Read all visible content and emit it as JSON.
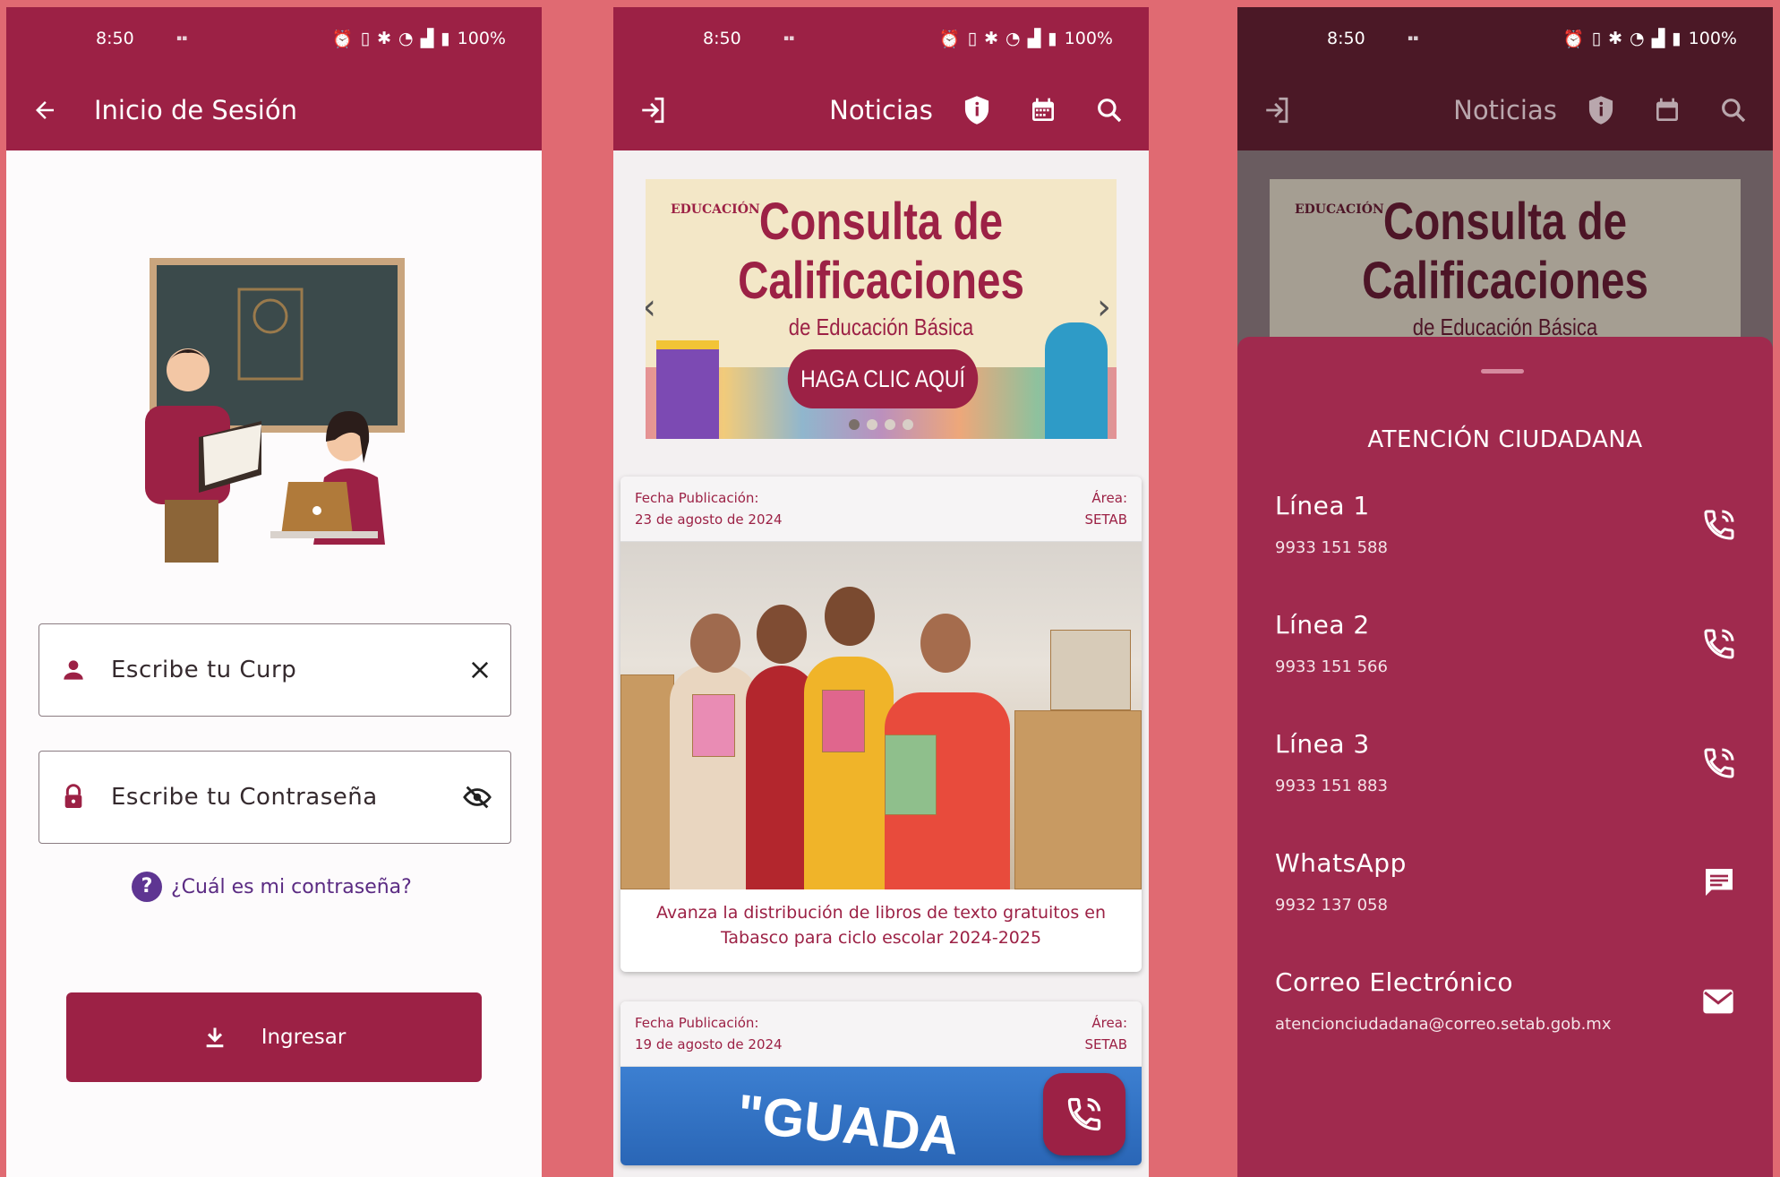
{
  "status_bar": {
    "time": "8:50",
    "battery": "100%"
  },
  "login": {
    "title": "Inicio de Sesión",
    "curp_placeholder": "Escribe tu Curp",
    "password_placeholder": "Escribe tu Contraseña",
    "help_link": "¿Cuál es mi contraseña?",
    "login_button": "Ingresar"
  },
  "news": {
    "title": "Noticias",
    "banner": {
      "brand": "EDUCACIÓN",
      "line1": "Consulta de",
      "line2": "Calificaciones",
      "line3": "de Educación Básica",
      "cta": "HAGA CLIC AQUÍ"
    },
    "cards": [
      {
        "date_label": "Fecha Publicación:",
        "date": "23 de agosto de 2024",
        "area_label": "Área:",
        "area": "SETAB",
        "caption": "Avanza la distribución de libros de texto gratuitos en Tabasco para ciclo escolar 2024-2025"
      },
      {
        "date_label": "Fecha Publicación:",
        "date": "19 de agosto de 2024",
        "area_label": "Área:",
        "area": "SETAB",
        "sign_text": "\"GUADA"
      }
    ]
  },
  "attention": {
    "title": "ATENCIÓN CIUDADANA",
    "contacts": [
      {
        "name": "Línea 1",
        "value": "9933 151 588",
        "action_icon": "phone-call-icon"
      },
      {
        "name": "Línea 2",
        "value": "9933 151 566",
        "action_icon": "phone-call-icon"
      },
      {
        "name": "Línea 3",
        "value": "9933 151 883",
        "action_icon": "phone-call-icon"
      },
      {
        "name": "WhatsApp",
        "value": "9932 137 058",
        "action_icon": "message-icon"
      },
      {
        "name": "Correo Electrónico",
        "value": "atencionciudadana@correo.setab.gob.mx",
        "action_icon": "mail-icon"
      }
    ]
  },
  "colors": {
    "primary": "#9c2145",
    "background": "#e06a72",
    "sheet": "#a02a4e",
    "help_link": "#5b2b83"
  }
}
